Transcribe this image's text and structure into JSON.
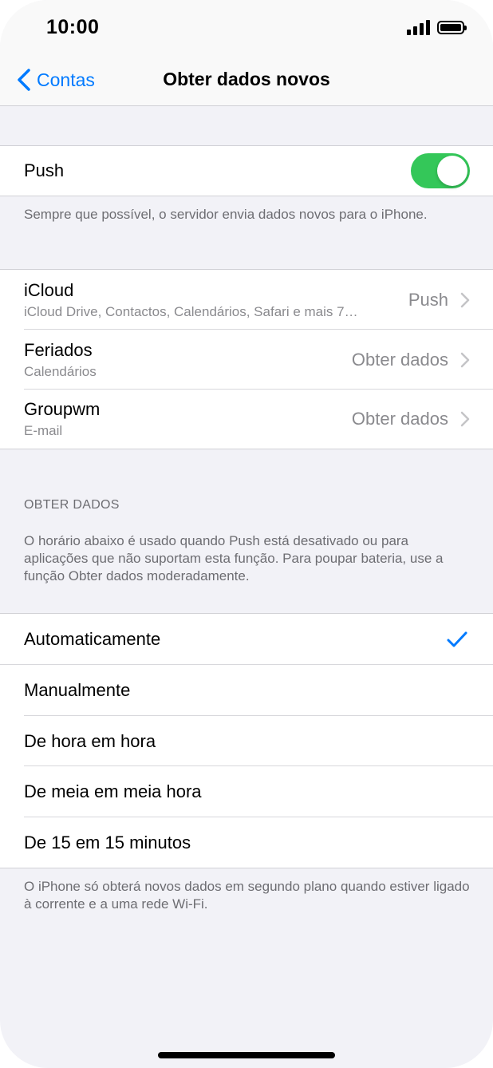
{
  "status_bar": {
    "time": "10:00"
  },
  "nav": {
    "back_label": "Contas",
    "title": "Obter dados novos"
  },
  "push_section": {
    "label": "Push",
    "toggle_on": true,
    "footnote": "Sempre que possível, o servidor envia dados novos para o iPhone."
  },
  "accounts": [
    {
      "name": "iCloud",
      "detail": "iCloud Drive, Contactos, Calendários, Safari e mais 7…",
      "value": "Push"
    },
    {
      "name": "Feriados",
      "detail": "Calendários",
      "value": "Obter dados"
    },
    {
      "name": "Groupwm",
      "detail": "E-mail",
      "value": "Obter dados"
    }
  ],
  "fetch_section": {
    "header": "OBTER DADOS",
    "description": "O horário abaixo é usado quando Push está desativado ou para aplicações que não suportam esta função. Para poupar bateria, use a função Obter dados moderadamente.",
    "options": [
      {
        "label": "Automaticamente",
        "selected": true
      },
      {
        "label": "Manualmente",
        "selected": false
      },
      {
        "label": "De hora em hora",
        "selected": false
      },
      {
        "label": "De meia em meia hora",
        "selected": false
      },
      {
        "label": "De 15 em 15 minutos",
        "selected": false
      }
    ],
    "footnote": "O iPhone só obterá novos dados em segundo plano quando estiver ligado à corrente e a uma rede Wi-Fi."
  },
  "colors": {
    "accent": "#007aff",
    "toggle_on": "#34c759",
    "background": "#f2f2f7"
  }
}
